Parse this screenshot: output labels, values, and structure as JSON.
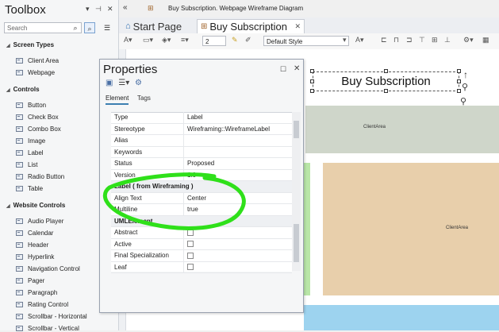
{
  "toolbox": {
    "title": "Toolbox",
    "search_placeholder": "Search",
    "sections": [
      {
        "title": "Screen Types",
        "items": [
          "Client Area",
          "Webpage"
        ]
      },
      {
        "title": "Controls",
        "items": [
          "Button",
          "Check Box",
          "Combo Box",
          "Image",
          "Label",
          "List",
          "Radio Button",
          "Table"
        ]
      },
      {
        "title": "Website Controls",
        "items": [
          "Audio Player",
          "Calendar",
          "Header",
          "Hyperlink",
          "Navigation Control",
          "Pager",
          "Paragraph",
          "Rating Control",
          "Scrollbar - Horizontal",
          "Scrollbar - Vertical"
        ]
      }
    ]
  },
  "header": {
    "breadcrumb": "Buy Subscription.  Webpage Wireframe Diagram",
    "tabs": [
      {
        "label": "Start Page"
      },
      {
        "label": "Buy Subscription"
      }
    ],
    "font_size": "2",
    "style_select": "Default Style"
  },
  "canvas": {
    "label_text": "Buy Subscription",
    "client_area_label": "ClientArea",
    "client_area_label_2": "ClientArea",
    "colors": {
      "top": "#cfd6ca",
      "left": "#b9e6a7",
      "right": "#e8cfab",
      "bottom": "#9dd3ef"
    }
  },
  "properties": {
    "title": "Properties",
    "tabs": [
      "Element",
      "Tags"
    ],
    "rows": [
      {
        "key": "Type",
        "value": "Label"
      },
      {
        "key": "Stereotype",
        "value": "Wireframing::WireframeLabel"
      },
      {
        "key": "Alias",
        "value": ""
      },
      {
        "key": "Keywords",
        "value": ""
      },
      {
        "key": "Status",
        "value": "Proposed"
      },
      {
        "key": "Version",
        "value": "1.0"
      }
    ],
    "section_label": "Label  ( from Wireframing )",
    "label_rows": [
      {
        "key": "Align Text",
        "value": "Center"
      },
      {
        "key": "Multiline",
        "value": "true"
      }
    ],
    "section_uml": "UMLElement",
    "uml_rows": [
      {
        "key": "Abstract"
      },
      {
        "key": "Active"
      },
      {
        "key": "Final Specialization"
      },
      {
        "key": "Leaf"
      }
    ]
  },
  "annotation_color": "#2fe01a"
}
